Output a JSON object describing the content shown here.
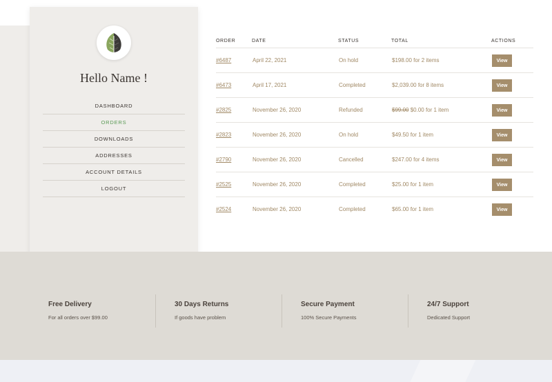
{
  "account": {
    "greeting": "Hello Name !",
    "menu": [
      {
        "label": "DASHBOARD",
        "active": false
      },
      {
        "label": "ORDERS",
        "active": true
      },
      {
        "label": "DOWNLOADS",
        "active": false
      },
      {
        "label": "ADDRESSES",
        "active": false
      },
      {
        "label": "ACCOUNT DETAILS",
        "active": false
      },
      {
        "label": "LOGOUT",
        "active": false
      }
    ]
  },
  "orders": {
    "headers": {
      "order": "ORDER",
      "date": "DATE",
      "status": "STATUS",
      "total": "TOTAL",
      "actions": "ACTIONS"
    },
    "rows": [
      {
        "id": "#6487",
        "date": "April 22, 2021",
        "status": "On hold",
        "old_total": "",
        "total": "$198.00 for 2 items",
        "action": "View"
      },
      {
        "id": "#6473",
        "date": "April 17, 2021",
        "status": "Completed",
        "old_total": "",
        "total": "$2,039.00 for 8 items",
        "action": "View"
      },
      {
        "id": "#2825",
        "date": "November 26, 2020",
        "status": "Refunded",
        "old_total": "$99.00",
        "total": "$0.00 for 1 item",
        "action": "View"
      },
      {
        "id": "#2823",
        "date": "November 26, 2020",
        "status": "On hold",
        "old_total": "",
        "total": "$49.50 for 1 item",
        "action": "View"
      },
      {
        "id": "#2790",
        "date": "November 26, 2020",
        "status": "Cancelled",
        "old_total": "",
        "total": "$247.00 for 4 items",
        "action": "View"
      },
      {
        "id": "#2525",
        "date": "November 26, 2020",
        "status": "Completed",
        "old_total": "",
        "total": "$25.00 for 1 item",
        "action": "View"
      },
      {
        "id": "#2524",
        "date": "November 26, 2020",
        "status": "Completed",
        "old_total": "",
        "total": "$65.00 for 1 item",
        "action": "View"
      }
    ]
  },
  "features": [
    {
      "title": "Free Delivery",
      "subtitle": "For all orders over $99.00"
    },
    {
      "title": "30 Days Returns",
      "subtitle": "If goods have problem"
    },
    {
      "title": "Secure Payment",
      "subtitle": "100% Secure Payments"
    },
    {
      "title": "24/7 Support",
      "subtitle": "Dedicated Support"
    }
  ],
  "colors": {
    "accent": "#a58e6c",
    "active_menu": "#5a9a55",
    "footer_bg": "#dedbd5"
  },
  "icons": {
    "avatar": "leaf-logo-icon"
  }
}
